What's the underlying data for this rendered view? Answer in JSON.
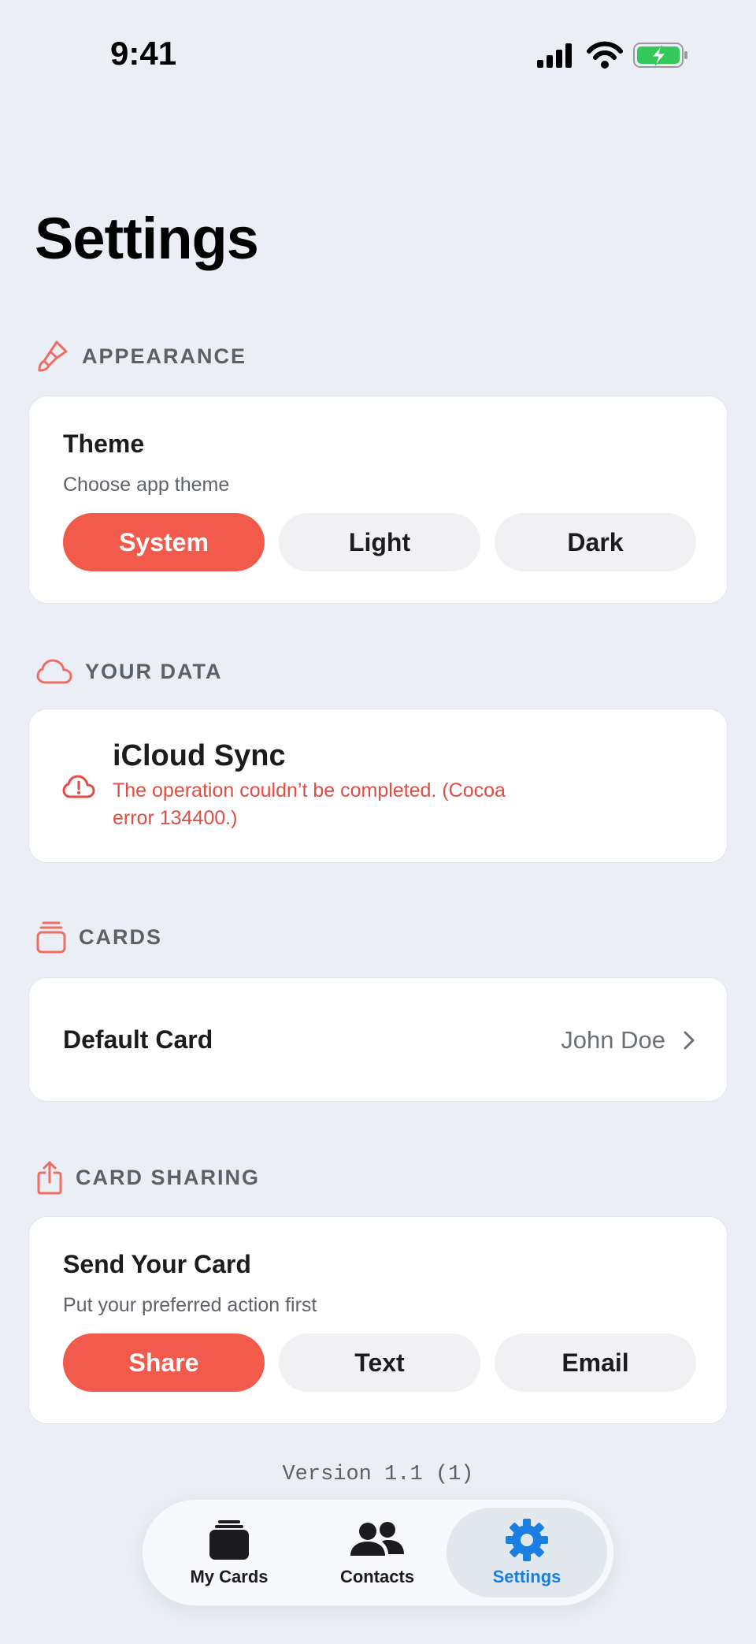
{
  "status_bar": {
    "time": "9:41"
  },
  "page": {
    "title": "Settings"
  },
  "sections": {
    "appearance": {
      "header": "APPEARANCE",
      "icon": "paintbrush-icon",
      "theme_title": "Theme",
      "theme_subtitle": "Choose app theme",
      "options": [
        "System",
        "Light",
        "Dark"
      ],
      "selected": "System"
    },
    "your_data": {
      "header": "YOUR DATA",
      "icon": "cloud-icon",
      "sync_title": "iCloud Sync",
      "error_line1": "The operation couldn’t be completed. (Cocoa",
      "error_line2": "error 134400.)"
    },
    "cards": {
      "header": "CARDS",
      "icon": "cards-stack-icon",
      "default_card_label": "Default Card",
      "default_card_value": "John Doe"
    },
    "card_sharing": {
      "header": "CARD SHARING",
      "icon": "share-icon",
      "send_title": "Send Your Card",
      "send_subtitle": "Put your preferred action first",
      "options": [
        "Share",
        "Text",
        "Email"
      ],
      "selected": "Share"
    }
  },
  "version": "Version 1.1 (1)",
  "tab_bar": {
    "tabs": [
      {
        "label": "My Cards",
        "icon": "cards-icon"
      },
      {
        "label": "Contacts",
        "icon": "people-icon"
      },
      {
        "label": "Settings",
        "icon": "gear-icon"
      }
    ],
    "active": "Settings"
  },
  "colors": {
    "accent": "#F25A4B",
    "error": "#E24C42",
    "tab_active": "#1A7FE0",
    "background": "#EBEFF5",
    "battery": "#34C759"
  }
}
